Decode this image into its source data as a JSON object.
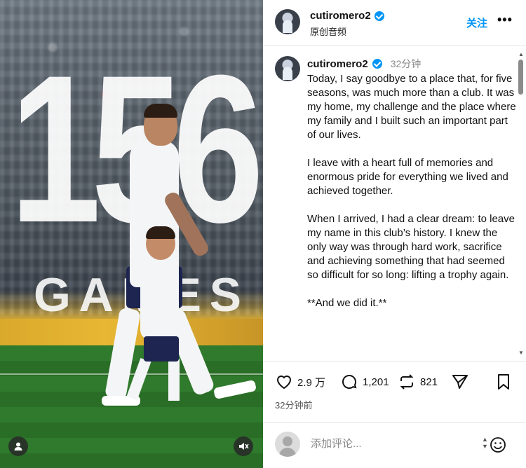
{
  "media": {
    "big_number": "156",
    "games_letters": [
      "G",
      "A",
      "M",
      "E",
      "S"
    ]
  },
  "header": {
    "username": "cutiromero2",
    "subtitle": "原创音频",
    "follow_label": "关注",
    "more_label": "•••"
  },
  "post": {
    "username": "cutiromero2",
    "time_ago": "32分钟",
    "caption": [
      "Today, I say goodbye to a place that, for five seasons, was much more than a club. It was my home, my challenge and the place where my family and I built such an important part of our lives.",
      "I leave with a heart full of memories and enormous pride for everything we lived and achieved together.",
      "When I arrived, I had a clear dream: to leave my name in this club’s history. I knew the only way was through hard work, sacrifice and achieving something that had seemed so difficult for so long: lifting a trophy again.",
      "**And we did it.**"
    ]
  },
  "actions": {
    "likes": "2.9 万",
    "comments": "1,201",
    "reposts": "821",
    "posted": "32分钟前"
  },
  "composer": {
    "placeholder": "添加评论..."
  },
  "colors": {
    "accent": "#0095f6",
    "text": "#111111",
    "muted": "#888888"
  },
  "icons": {
    "like": "heart-icon",
    "comment": "comment-icon",
    "repost": "repost-icon",
    "share": "send-icon",
    "save": "bookmark-icon",
    "verified": "verified-badge-icon",
    "mute": "speaker-muted-icon",
    "user": "user-icon",
    "emoji": "smiley-icon"
  }
}
